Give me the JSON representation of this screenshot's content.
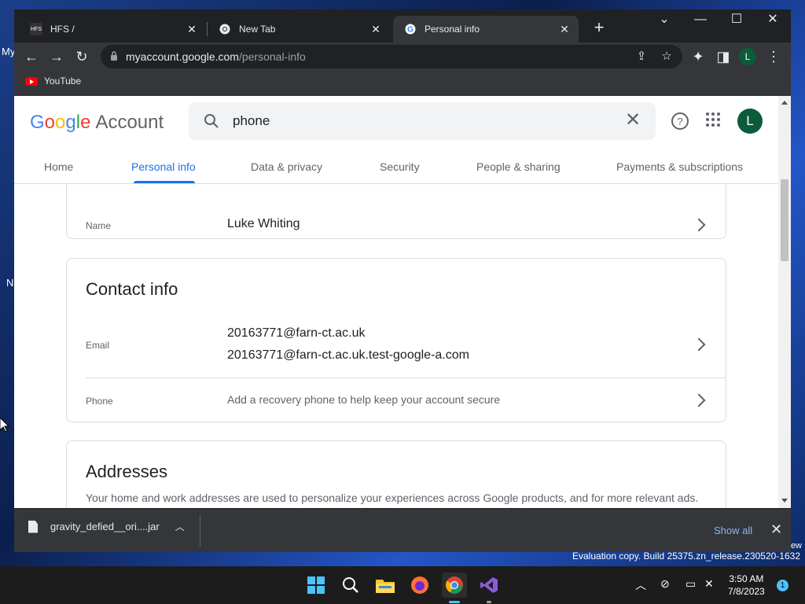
{
  "desktop": {
    "fragments": [
      "My",
      "N"
    ],
    "watermark": "Evaluation copy. Build 25375.zn_release.230520-1632",
    "watermark_top": "ew"
  },
  "browser": {
    "tabs": [
      {
        "title": "HFS /",
        "favicon": "hfs-icon",
        "favicon_text": "HFS"
      },
      {
        "title": "New Tab",
        "favicon": "chrome-icon"
      },
      {
        "title": "Personal info",
        "favicon": "google-icon",
        "active": true
      }
    ],
    "url": {
      "host": "myaccount.google.com",
      "path": "/personal-info"
    },
    "profile_initial": "L",
    "bookmarks": [
      {
        "label": "YouTube",
        "icon": "youtube-icon"
      }
    ]
  },
  "page": {
    "logo": {
      "G": "G",
      "o1": "o",
      "o2": "o",
      "g": "g",
      "l": "l",
      "e": "e",
      "suffix": "Account"
    },
    "search": {
      "value": "phone"
    },
    "avatar_initial": "L",
    "nav": [
      "Home",
      "Personal info",
      "Data & privacy",
      "Security",
      "People & sharing",
      "Payments & subscriptions"
    ],
    "name_card": {
      "label": "Name",
      "value": "Luke Whiting"
    },
    "contact": {
      "title": "Contact info",
      "email_label": "Email",
      "emails": [
        "20163771@farn-ct.ac.uk",
        "20163771@farn-ct.ac.uk.test-google-a.com"
      ],
      "phone_label": "Phone",
      "phone_hint": "Add a recovery phone to help keep your account secure"
    },
    "addresses": {
      "title": "Addresses",
      "desc": "Your home and work addresses are used to personalize your experiences across Google products, and for more relevant ads. Only you can see these addresses."
    }
  },
  "download": {
    "filename": "gravity_defied__ori....jar",
    "show_all": "Show all"
  },
  "taskbar": {
    "time": "3:50 AM",
    "date": "7/8/2023",
    "notifications": "1"
  }
}
